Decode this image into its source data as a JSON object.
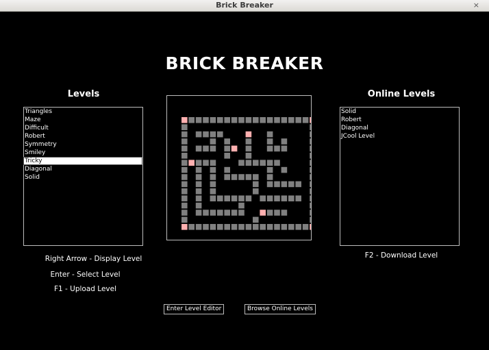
{
  "window": {
    "title": "Brick Breaker",
    "close_glyph": "×"
  },
  "game_title": "BRICK BREAKER",
  "levels": {
    "heading": "Levels",
    "items": [
      "Triangles",
      "Maze",
      "Difficult",
      "Robert",
      "Symmetry",
      "Smiley",
      "Tricky",
      "Diagonal",
      "Solid"
    ],
    "selected_index": 6
  },
  "online_levels": {
    "heading": "Online Levels",
    "items": [
      "Solid",
      "Robert",
      "Diagonal",
      "JCool Level"
    ]
  },
  "hints": {
    "display": "Right Arrow - Display Level",
    "select": "Enter - Select Level",
    "upload": "F1 - Upload Level",
    "download": "F2 - Download Level"
  },
  "buttons": {
    "level_editor": "Enter Level Editor",
    "browse_online": "Browse Online Levels"
  },
  "colors": {
    "brick": "#808080",
    "special_brick": "#ffb0b0"
  },
  "preview_grid": [
    "P#################P",
    "#.................#",
    "#.####...P..#.....#",
    "#...#.#..#..#.#...#",
    "#.###.#P.#..###...#",
    "#.....#..#........#",
    "#P###...######....#",
    "#.#.#.#.....#.#...#",
    "#.#.#.#####.#.....#",
    "#.#.#.....#.#####.#",
    "#.#.#.....#.......#",
    "#.#.######.######.#",
    "#.#.....#.........#",
    "#.#######..P###...#",
    "#.........#.......#",
    "P#################P"
  ]
}
